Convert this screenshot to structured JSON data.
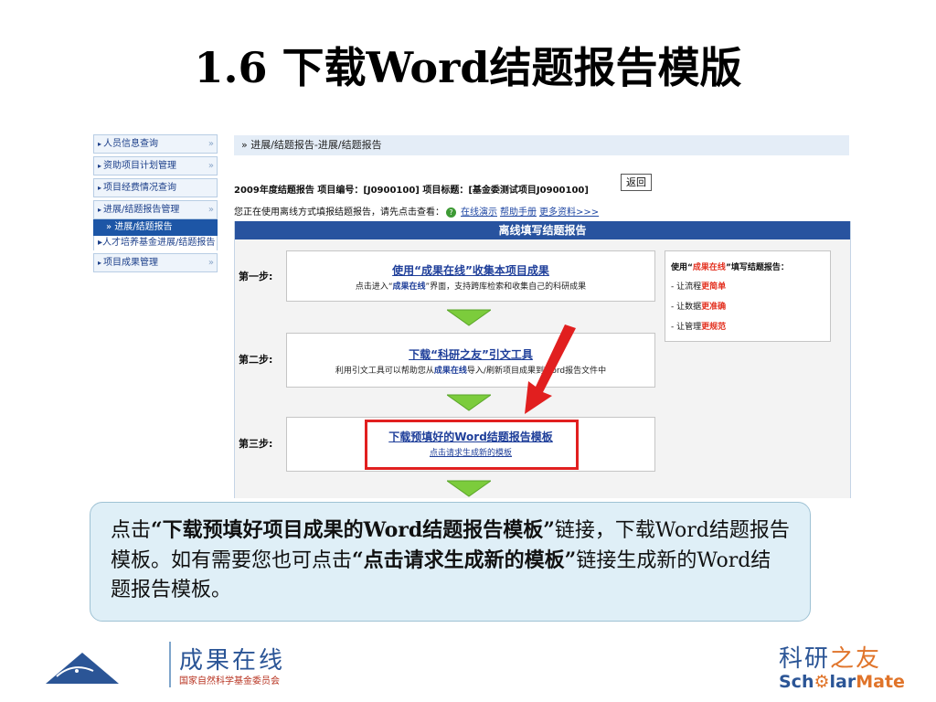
{
  "slide": {
    "title": "1.6 下载Word结题报告模版"
  },
  "sidebar": {
    "items": [
      {
        "label": "人员信息查询",
        "chevron": "»"
      },
      {
        "label": "资助项目计划管理",
        "chevron": "»"
      },
      {
        "label": "项目经费情况查询",
        "chevron": ""
      },
      {
        "label": "进展/结题报告管理",
        "chevron": "»"
      }
    ],
    "active_sub": "» 进展/结题报告",
    "sub_item": "人才培养基金进展/结题报告",
    "last_item": {
      "label": "项目成果管理",
      "chevron": "»"
    }
  },
  "breadcrumb": "» 进展/结题报告-进展/结题报告",
  "project_info": "2009年度结题报告  项目编号：[J0900100]  项目标题：[基金委测试项目J0900100]",
  "return_button": "返回",
  "notice": {
    "text": "您正在使用离线方式填报结题报告，请先点击查看：",
    "links": [
      "在线演示",
      "帮助手册",
      "更多资料>>>"
    ]
  },
  "panel": {
    "header": "离线填写结题报告",
    "steps": [
      {
        "label": "第一步:",
        "title": "使用“成果在线”收集本项目成果",
        "desc_pre": "点击进入“",
        "desc_em": "成果在线",
        "desc_post": "”界面，支持跨库检索和收集自己的科研成果"
      },
      {
        "label": "第二步:",
        "title": "下载“科研之友”引文工具",
        "desc_pre": "利用引文工具可以帮助您从",
        "desc_em": "成果在线",
        "desc_post": "导入/刷新项目成果到Word报告文件中"
      },
      {
        "label": "第三步:",
        "title": "下载预填好的Word结题报告模板",
        "link": "点击请求生成新的模板"
      }
    ],
    "side": {
      "title_pre": "使用“",
      "title_em": "成果在线",
      "title_post": "”填写结题报告：",
      "items": [
        {
          "pre": "- 让流程",
          "em": "更简单"
        },
        {
          "pre": "- 让数据",
          "em": "更准确"
        },
        {
          "pre": "- 让管理",
          "em": "更规范"
        }
      ]
    }
  },
  "callout": {
    "p1": "点击",
    "b1": "“下载预填好项目成果的Word结题报告模板”",
    "p2": "链接，下载Word结题报告模板。如有需要您也可点击",
    "b2": "“点击请求生成新的模板”",
    "p3": "链接生成新的Word结题报告模板。"
  },
  "logo_left": {
    "name": "成果在线",
    "sub": "国家自然科学基金委员会"
  },
  "logo_right": {
    "cn_a": "科研",
    "cn_b": "之友",
    "en_a": "Sch",
    "en_o": "⚙",
    "en_b": "lar",
    "en_c": "Mate"
  },
  "colors": {
    "header_blue": "#28539f",
    "highlight_red": "#e11f1f",
    "callout_bg": "#dfeff7"
  }
}
